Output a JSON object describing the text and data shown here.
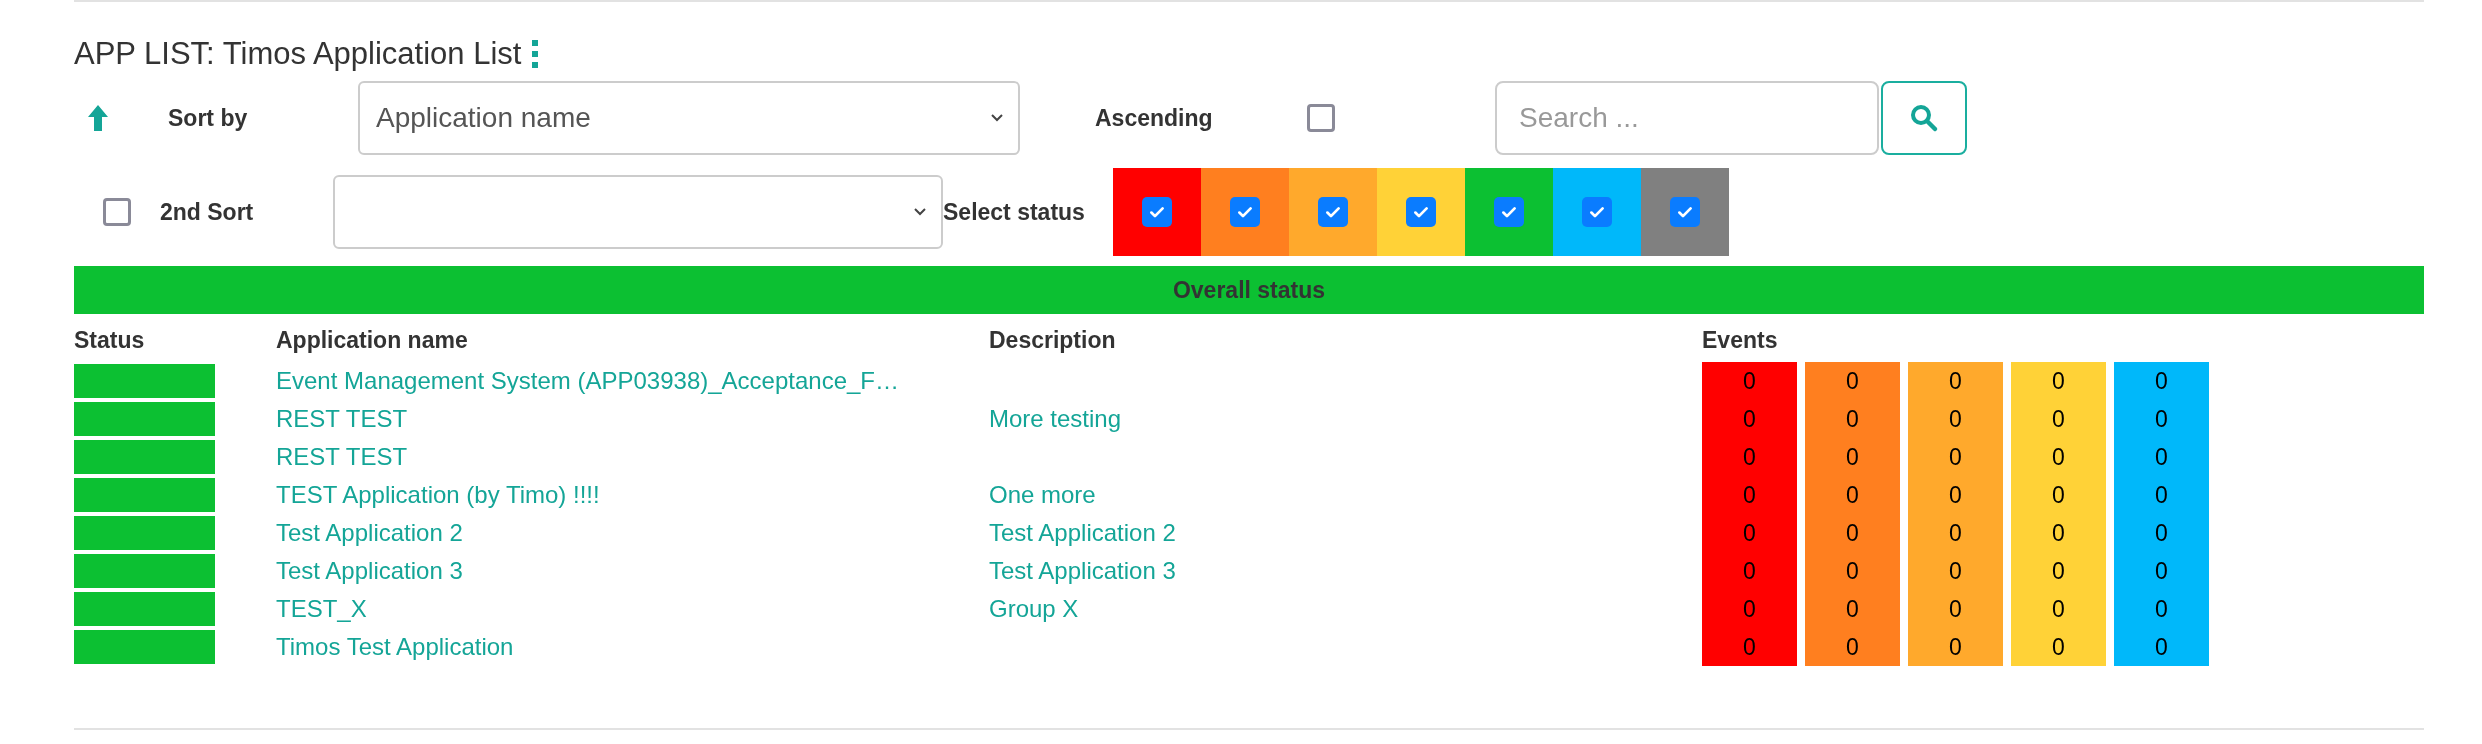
{
  "title": "APP LIST: Timos Application List",
  "sort": {
    "label": "Sort by",
    "value": "Application name",
    "ascending_label": "Ascending",
    "ascending": false
  },
  "search": {
    "placeholder": "Search ..."
  },
  "second_sort": {
    "checked": false,
    "label": "2nd Sort"
  },
  "status_filter": {
    "label": "Select status",
    "options": [
      {
        "color": "#ff0000",
        "checked": true
      },
      {
        "color": "#ff7f1f",
        "checked": true
      },
      {
        "color": "#ffa92c",
        "checked": true
      },
      {
        "color": "#ffd237",
        "checked": true
      },
      {
        "color": "#0cc032",
        "checked": true
      },
      {
        "color": "#00b8fa",
        "checked": true
      },
      {
        "color": "#808080",
        "checked": true
      }
    ]
  },
  "overall_status": {
    "label": "Overall status",
    "color": "#0cc032"
  },
  "table": {
    "columns": [
      "Status",
      "Application name",
      "Description",
      "Events"
    ],
    "event_columns": [
      {
        "color": "#ff0000"
      },
      {
        "color": "#ff7f1f"
      },
      {
        "color": "#ffa92c"
      },
      {
        "color": "#ffd237"
      },
      {
        "color": "#00b8fa"
      }
    ],
    "rows": [
      {
        "color": "#0cc032",
        "name": "Event Management System (APP03938)_Acceptance_F…",
        "events": [
          "0",
          "0",
          "0",
          "0",
          "0"
        ]
      },
      {
        "color": "#0cc032",
        "name": "REST TEST",
        "description": "More testing",
        "events": [
          "0",
          "0",
          "0",
          "0",
          "0"
        ]
      },
      {
        "color": "#0cc032",
        "name": "REST TEST",
        "events": [
          "0",
          "0",
          "0",
          "0",
          "0"
        ]
      },
      {
        "color": "#0cc032",
        "name": "TEST Application (by Timo) !!!!",
        "description": "One more",
        "events": [
          "0",
          "0",
          "0",
          "0",
          "0"
        ]
      },
      {
        "color": "#0cc032",
        "name": "Test Application 2",
        "description": "Test Application 2",
        "events": [
          "0",
          "0",
          "0",
          "0",
          "0"
        ]
      },
      {
        "color": "#0cc032",
        "name": "Test Application 3",
        "description": "Test Application 3",
        "events": [
          "0",
          "0",
          "0",
          "0",
          "0"
        ]
      },
      {
        "color": "#0cc032",
        "name": "TEST_X",
        "description": "Group X",
        "events": [
          "0",
          "0",
          "0",
          "0",
          "0"
        ]
      },
      {
        "color": "#0cc032",
        "name": "Timos Test Application",
        "events": [
          "0",
          "0",
          "0",
          "0",
          "0"
        ]
      }
    ]
  }
}
